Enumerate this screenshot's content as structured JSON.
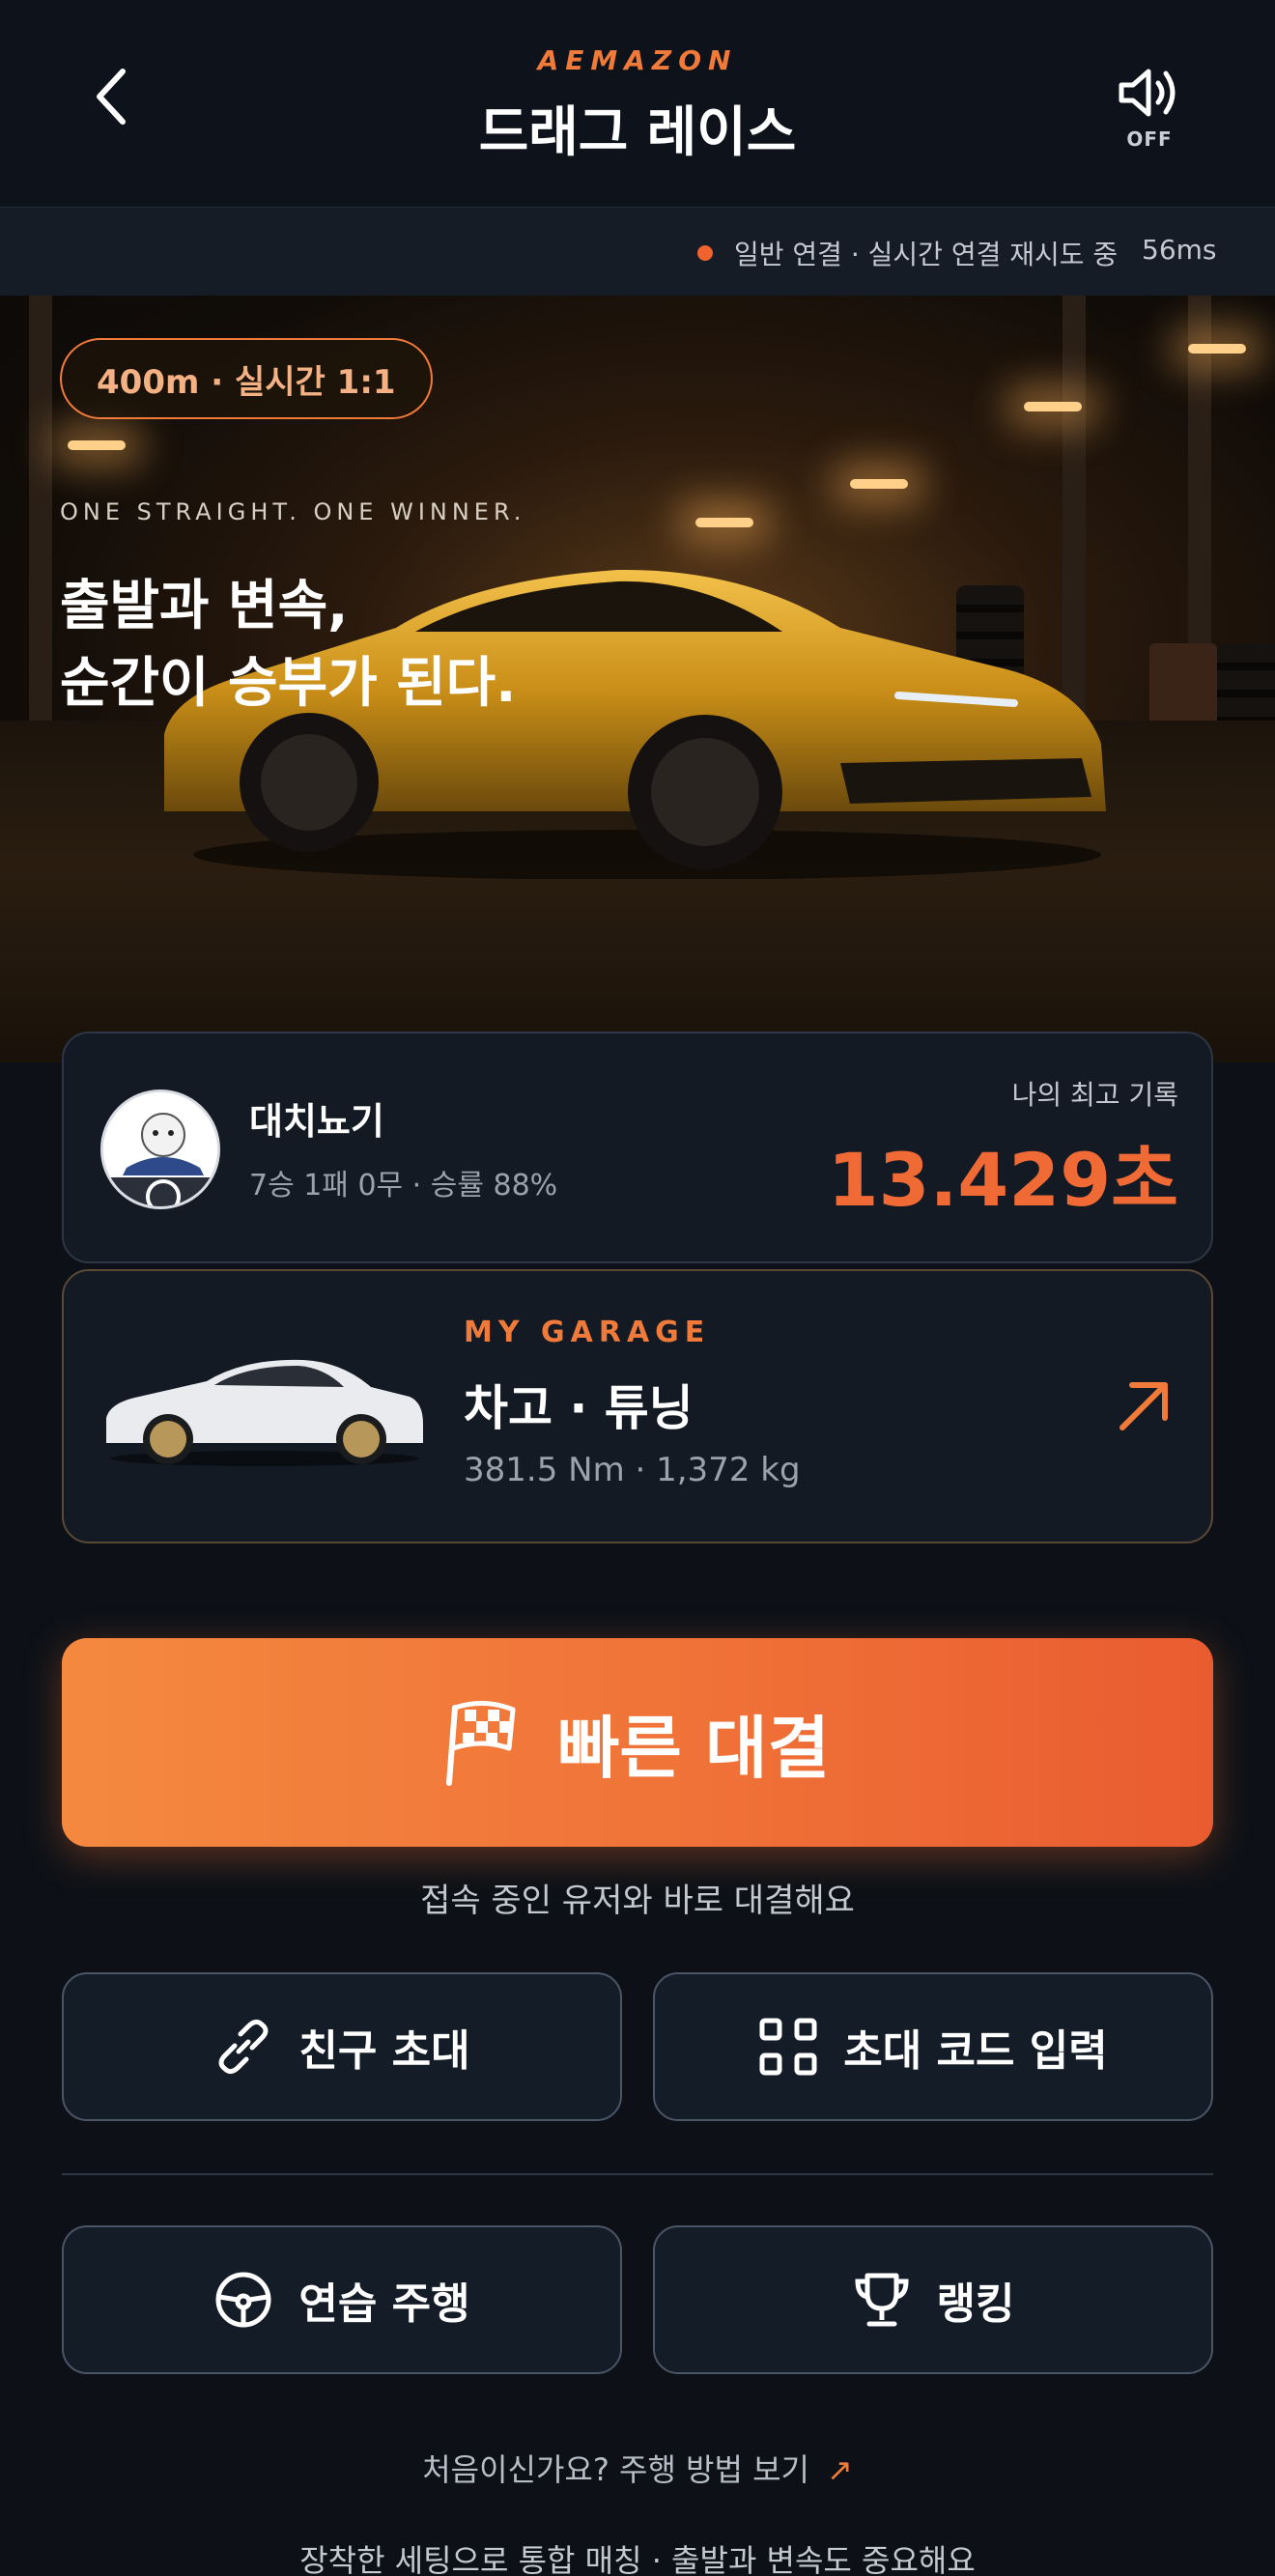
{
  "header": {
    "brand": "AEMAZON",
    "title": "드래그 레이스",
    "sound_state": "OFF",
    "back_icon": "chevron-left-icon",
    "sound_icon": "speaker-icon"
  },
  "connection": {
    "status_text": "일반 연결 · 실시간 연결 재시도 중",
    "latency": "56ms",
    "dot_color": "#f0622e"
  },
  "hero": {
    "badge": "400m · 실시간 1:1",
    "tagline": "ONE STRAIGHT. ONE WINNER.",
    "headline_line1": "출발과 변속,",
    "headline_line2": "순간이 승부가 된다."
  },
  "profile": {
    "name": "대치뇨기",
    "stats": "7승 1패 0무 · 승률 88%",
    "best_label": "나의 최고 기록",
    "best_value": "13.429초"
  },
  "garage": {
    "kicker": "MY GARAGE",
    "title": "차고 · 튜닝",
    "spec": "381.5 Nm · 1,372 kg"
  },
  "actions": {
    "quick_match": "빠른 대결",
    "quick_match_sub": "접속 중인 유저와 바로 대결해요",
    "invite_friend": "친구 초대",
    "enter_code": "초대 코드 입력",
    "practice": "연습 주행",
    "ranking": "랭킹"
  },
  "help": {
    "link": "처음이신가요? 주행 방법 보기",
    "arrow": "↗",
    "footer": "장착한 세팅으로 통합 매칭 · 출발과 변속도 중요해요"
  },
  "colors": {
    "accent": "#f07a3a",
    "background": "#0d1117",
    "card": "#141a24"
  }
}
